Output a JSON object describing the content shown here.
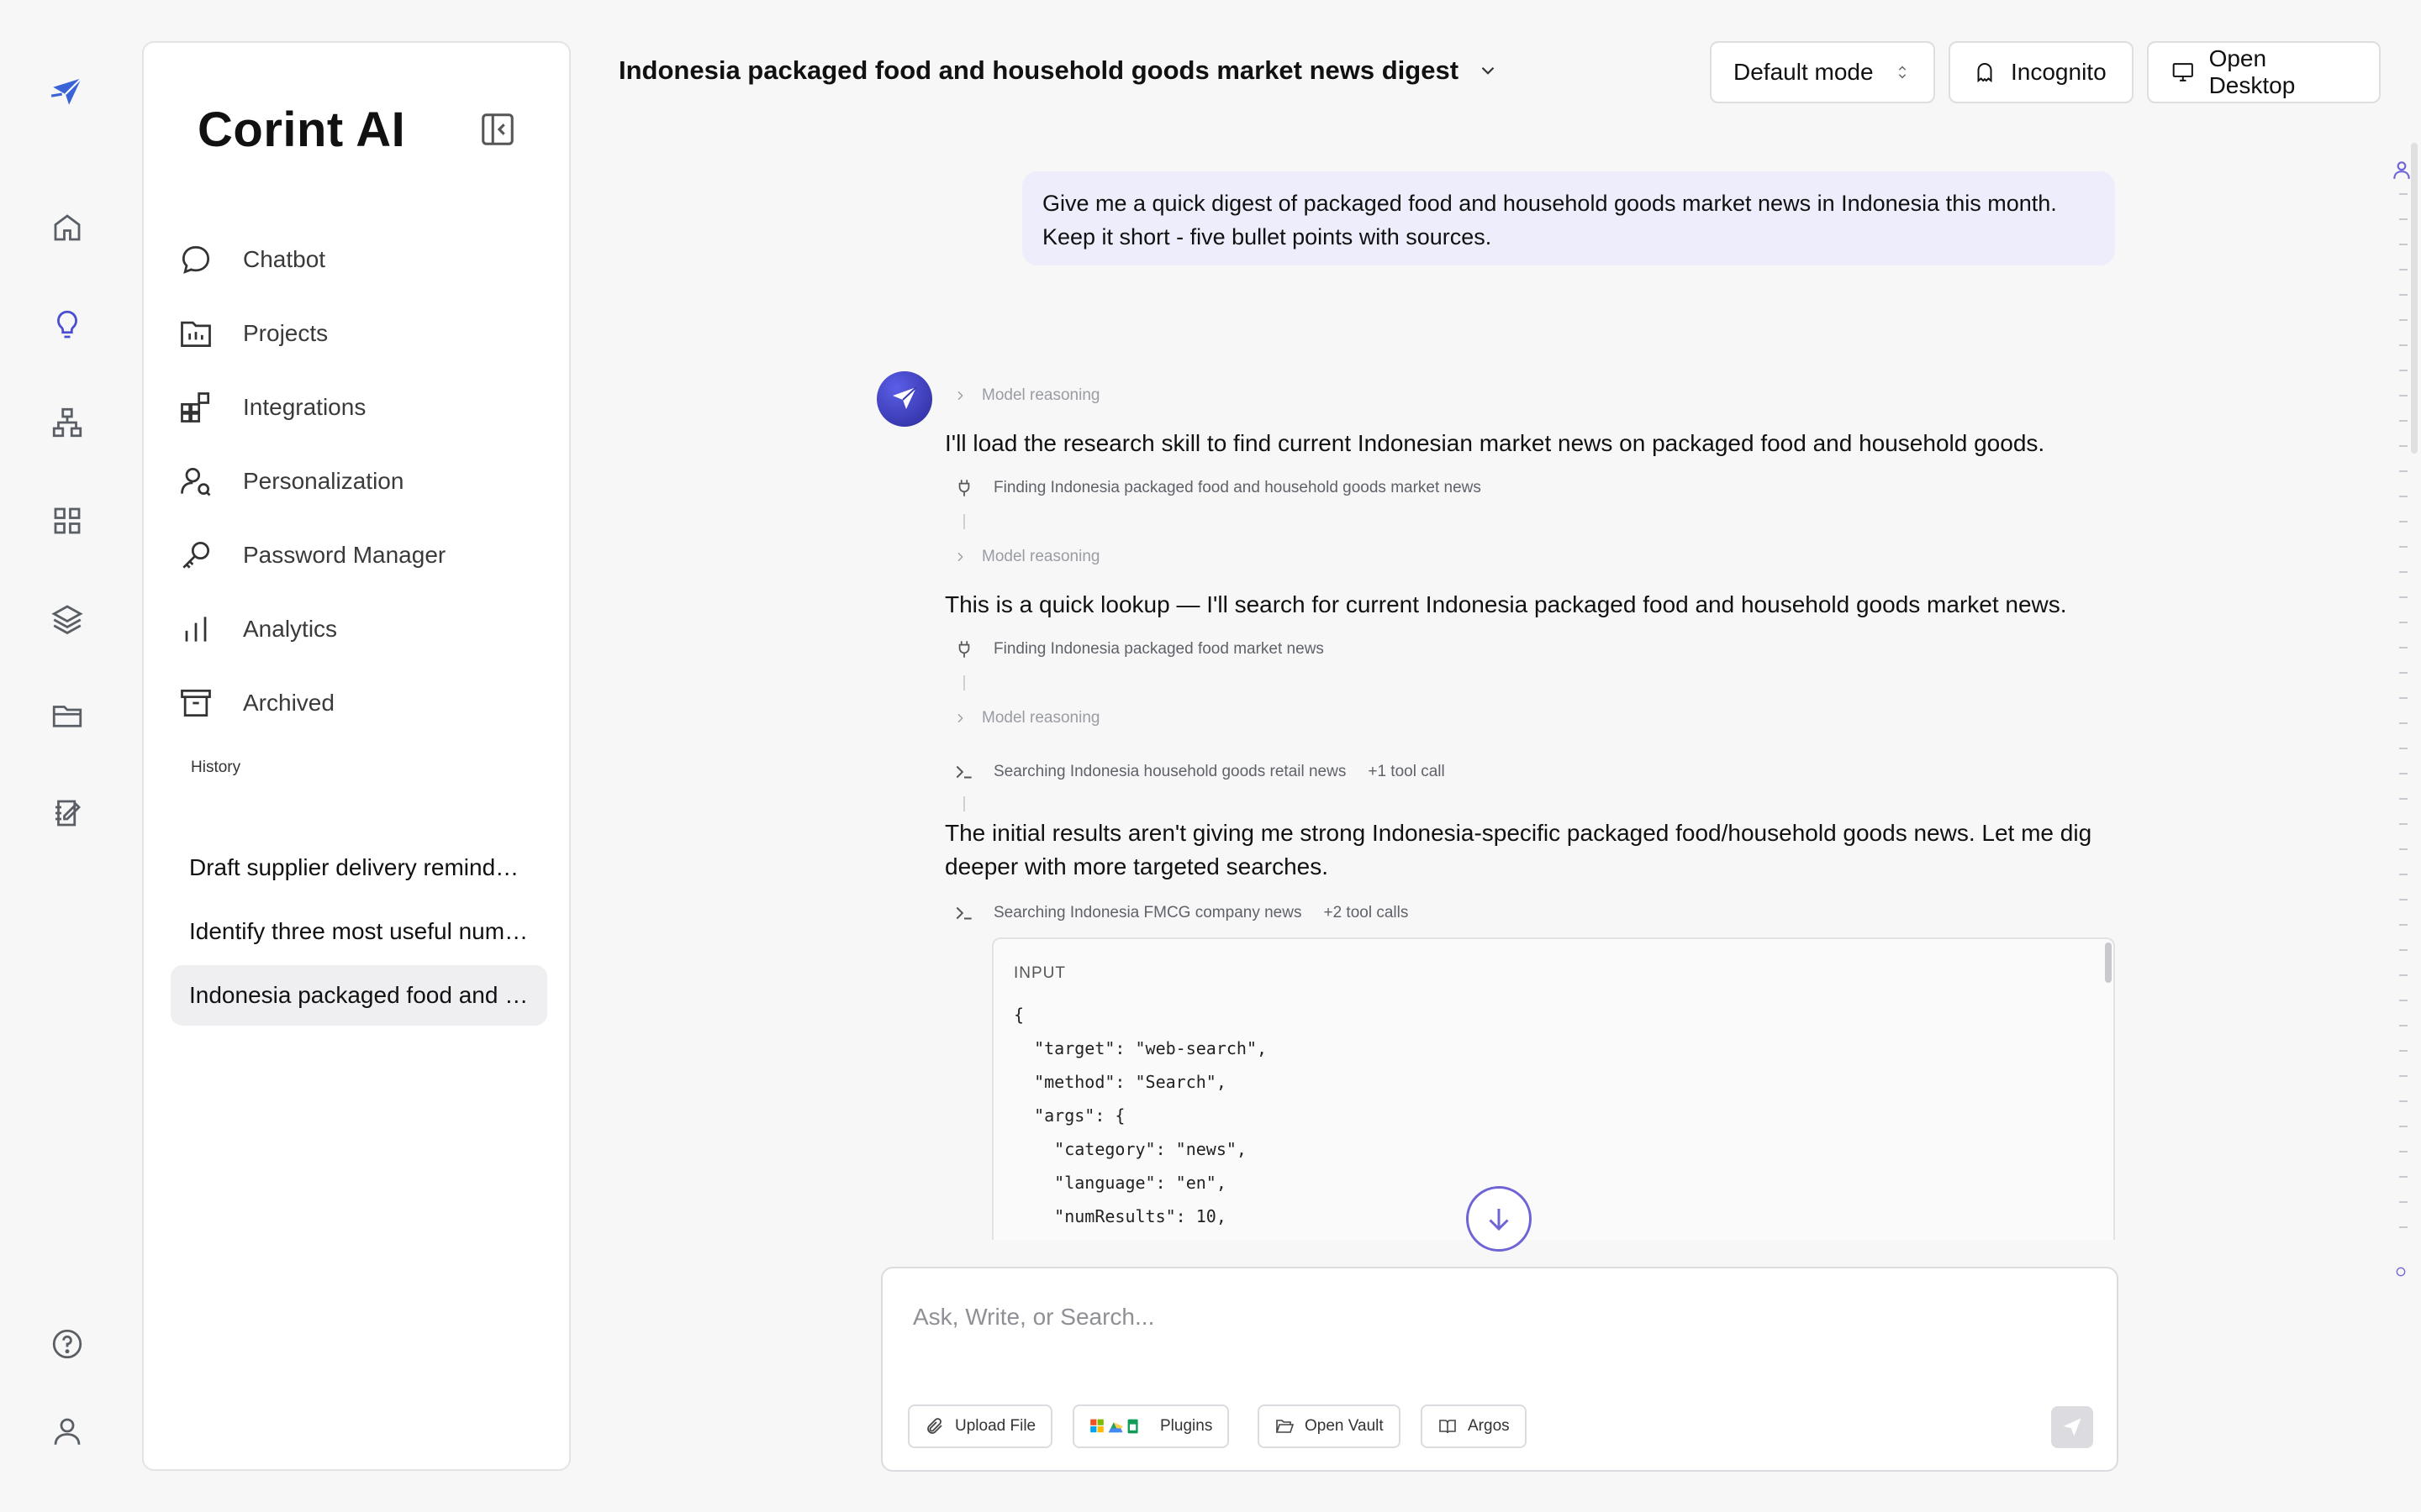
{
  "app": {
    "brand": "Corint AI"
  },
  "rail": {
    "icons": [
      "logo-icon",
      "home-icon",
      "lightbulb-icon",
      "hierarchy-icon",
      "grid-icon",
      "layers-icon",
      "folder-icon",
      "notebook-icon",
      "help-icon",
      "user-icon"
    ]
  },
  "sidebar": {
    "nav": [
      {
        "label": "Chatbot",
        "icon": "chat-bubble-icon"
      },
      {
        "label": "Projects",
        "icon": "project-folder-icon"
      },
      {
        "label": "Integrations",
        "icon": "integrations-icon"
      },
      {
        "label": "Personalization",
        "icon": "user-search-icon"
      },
      {
        "label": "Password Manager",
        "icon": "key-icon"
      },
      {
        "label": "Analytics",
        "icon": "bar-chart-icon"
      },
      {
        "label": "Archived",
        "icon": "archive-icon"
      }
    ],
    "history_label": "History",
    "history": [
      "Draft supplier delivery reminder for Monday",
      "Identify three most useful numbers",
      "Indonesia packaged food and household goods market news digest"
    ]
  },
  "header": {
    "title": "Indonesia packaged food and household goods market news digest",
    "mode": "Default mode",
    "incognito": "Incognito",
    "open_desktop": "Open Desktop"
  },
  "chat": {
    "user_message": "Give me a quick digest of packaged food and household goods market news in Indonesia this month. Keep it short - five bullet points with sources.",
    "reasoning_label": "Model reasoning",
    "msg1": "I'll load the research skill to find current Indonesian market news on packaged food and household goods.",
    "tool1": "Finding Indonesia packaged food and household goods market news",
    "msg2": "This is a quick lookup — I'll search for current Indonesia packaged food and household goods market news.",
    "tool2": "Finding Indonesia packaged food market news",
    "tool3": "Searching Indonesia household goods retail news",
    "tool3_extra": "+1 tool call",
    "msg3": "The initial results aren't giving me strong Indonesia-specific packaged food/household goods news. Let me dig deeper with more targeted searches.",
    "tool4": "Searching Indonesia FMCG company news",
    "tool4_extra": "+2 tool calls",
    "code_label": "INPUT",
    "code": "{\n  \"target\": \"web-search\",\n  \"method\": \"Search\",\n  \"args\": {\n    \"category\": \"news\",\n    \"language\": \"en\",\n    \"numResults\": 10,"
  },
  "composer": {
    "placeholder": "Ask, Write, or Search...",
    "upload": "Upload File",
    "plugins": "Plugins",
    "vault": "Open Vault",
    "argos": "Argos"
  },
  "colors": {
    "accent": "#4a4fd0",
    "bubble": "#ededfb",
    "scroll_button": "#6e64d6"
  }
}
